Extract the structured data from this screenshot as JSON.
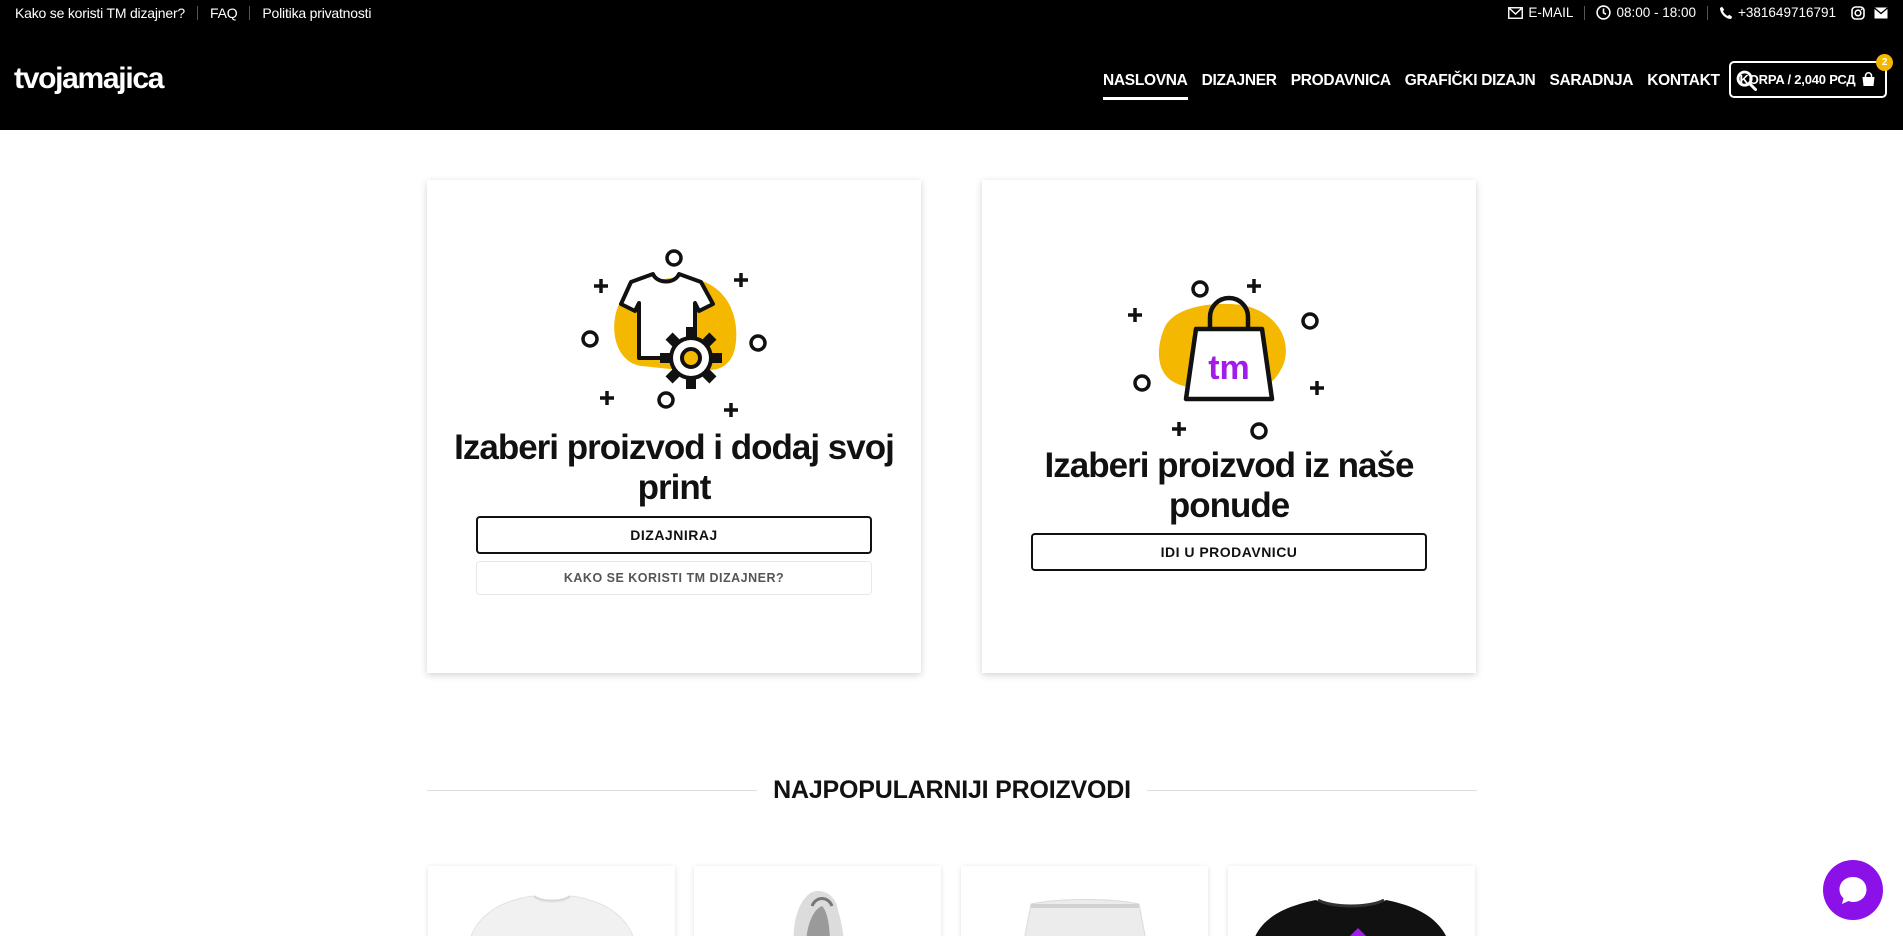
{
  "topbar": {
    "links": [
      "Kako se koristi TM dizajner?",
      "FAQ",
      "Politika privatnosti"
    ],
    "email_label": "E-MAIL",
    "hours": "08:00 - 18:00",
    "phone": "+381649716791",
    "icons": [
      "mail-icon",
      "clock-icon",
      "phone-icon",
      "instagram-icon",
      "mail-icon"
    ]
  },
  "header": {
    "logo": "tvojamajica",
    "nav": [
      "NASLOVNA",
      "DIZAJNER",
      "PRODAVNICA",
      "GRAFIČKI DIZAJN",
      "SARADNJA",
      "KONTAKT"
    ],
    "active_nav": "NASLOVNA",
    "cart_label": "KORPA / 2,040 РСД",
    "cart_count": "2"
  },
  "cards": [
    {
      "title": "Izaberi proizvod i dodaj svoj print",
      "primary_button": "DIZAJNIRAJ",
      "secondary_button": "KAKO SE KORISTI TM DIZAJNER?"
    },
    {
      "title": "Izaberi proizvod iz naše ponude",
      "primary_button": "IDI U PRODAVNICU",
      "badge_text": "tm"
    }
  ],
  "section": {
    "title": "NAJPOPULARNIJI PROIZVODI"
  },
  "colors": {
    "accent_yellow": "#f5b800",
    "accent_purple": "#a21ee8",
    "chat_purple": "#8c10e8",
    "header_bg": "#000000"
  }
}
